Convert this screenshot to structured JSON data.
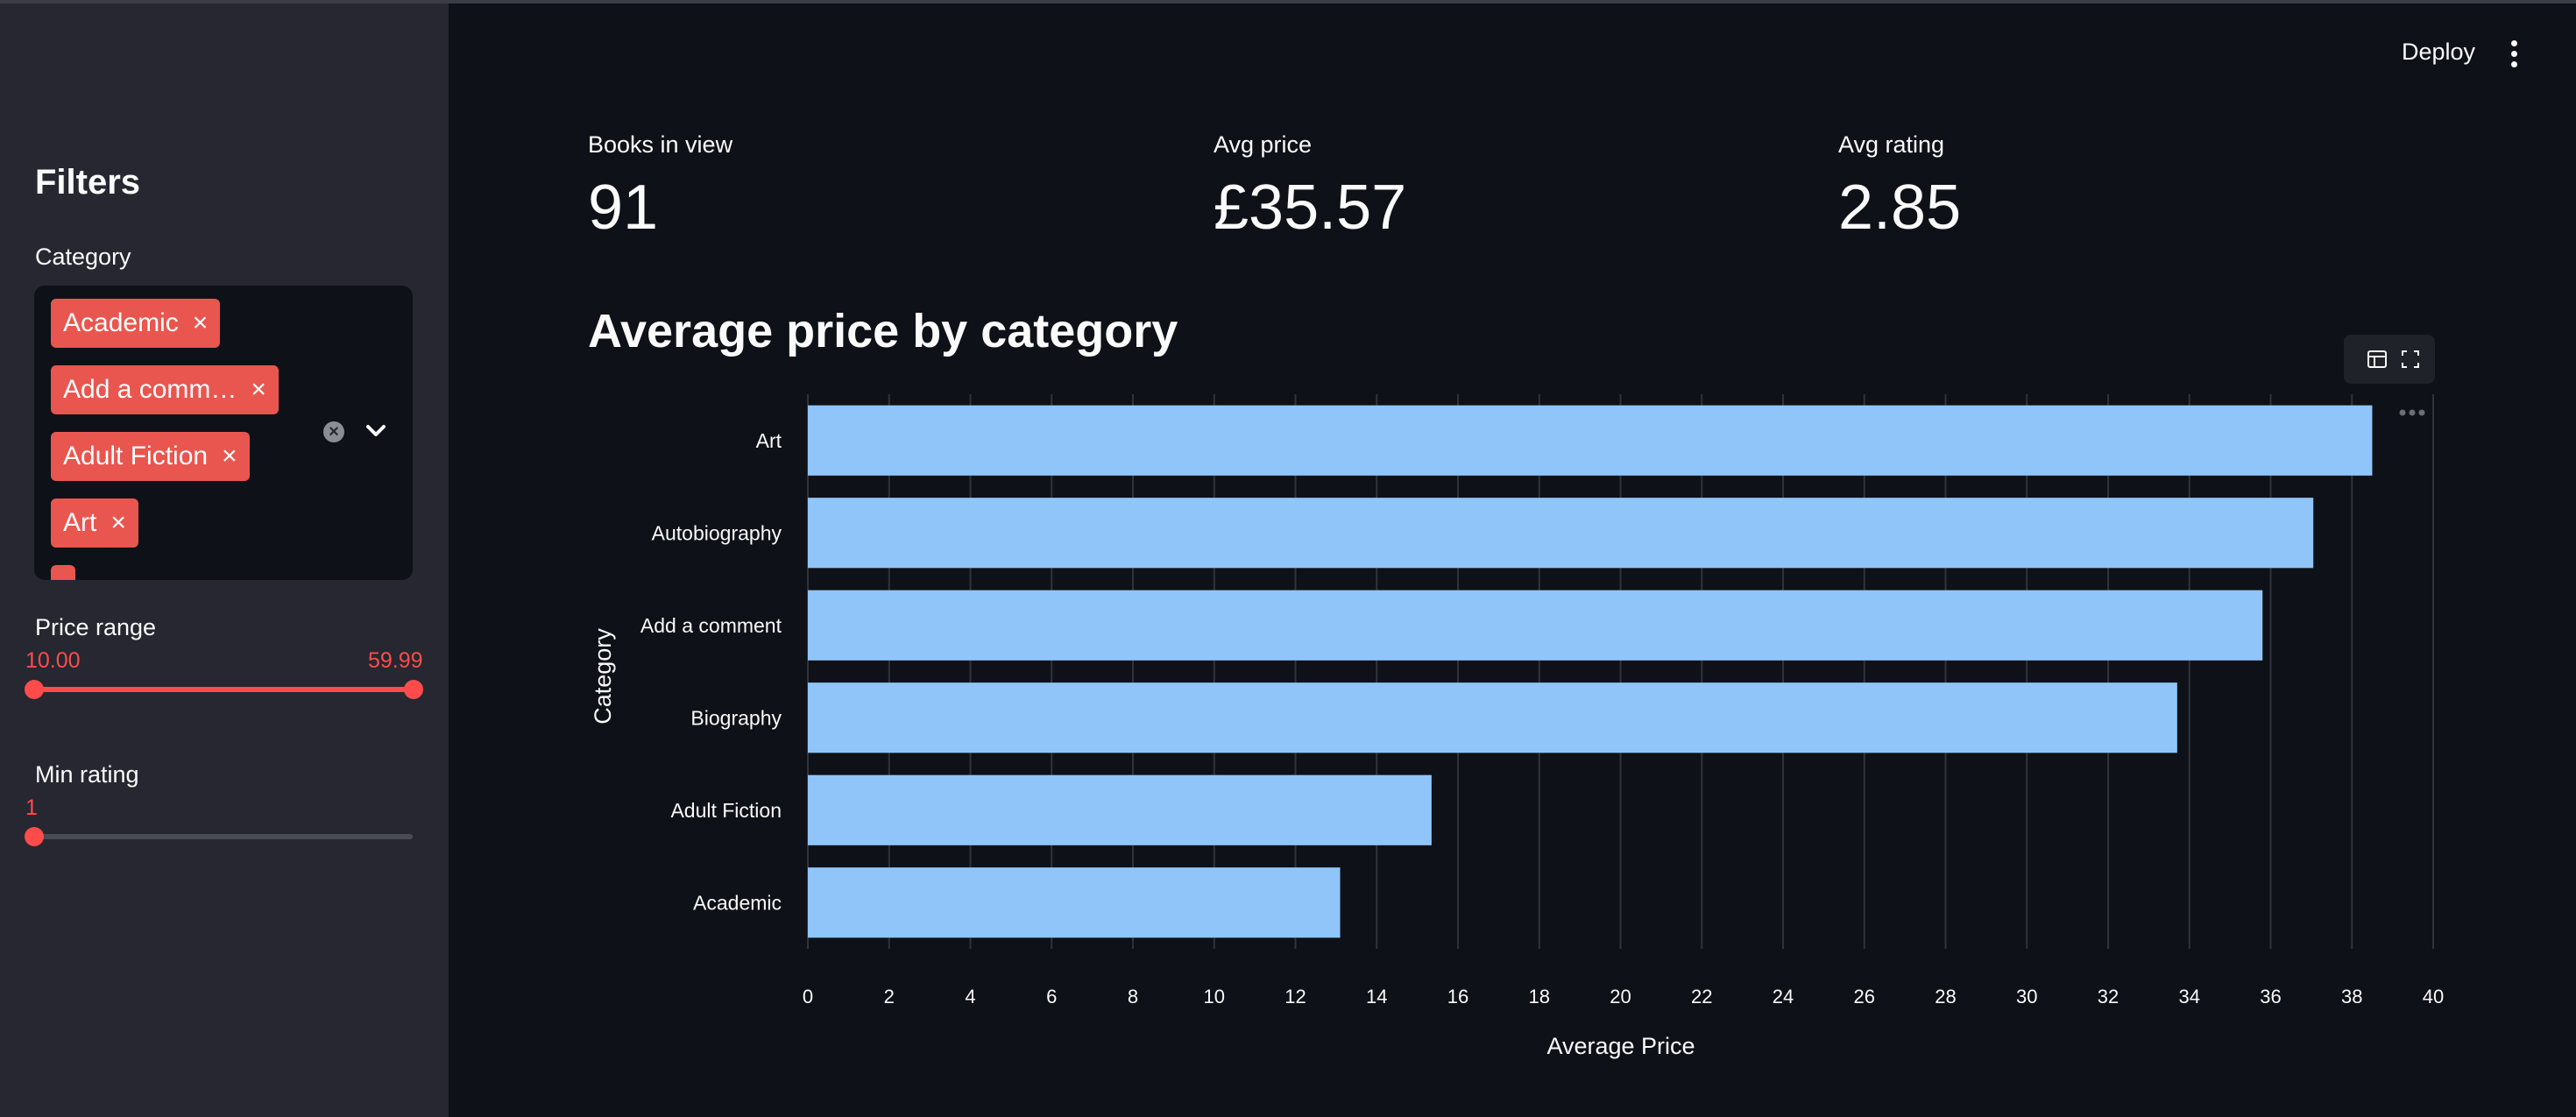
{
  "sidebar": {
    "title": "Filters",
    "category_label": "Category",
    "selected_categories": [
      "Academic",
      "Add a comm…",
      "Adult Fiction",
      "Art"
    ],
    "price_label": "Price range",
    "price_min": "10.00",
    "price_max": "59.99",
    "rating_label": "Min rating",
    "rating_value": "1"
  },
  "header": {
    "deploy_label": "Deploy"
  },
  "metrics": {
    "books_label": "Books in view",
    "books_value": "91",
    "price_label": "Avg price",
    "price_value": "£35.57",
    "rating_label": "Avg rating",
    "rating_value": "2.85"
  },
  "section_title": "Average price by category",
  "colors": {
    "accent": "#ff4b4b",
    "tag": "#e9564f",
    "bar": "#90c5fa",
    "background": "#0e1117",
    "sidebar": "#262730"
  },
  "icons": [
    "clear-icon",
    "chevron-down-icon",
    "table-icon",
    "fullscreen-icon",
    "more-options-icon",
    "kebab-menu-icon"
  ],
  "chart_data": {
    "type": "bar",
    "orientation": "horizontal",
    "categories": [
      "Art",
      "Autobiography",
      "Add a comment",
      "Biography",
      "Adult Fiction",
      "Academic"
    ],
    "values": [
      38.5,
      37.05,
      35.8,
      33.7,
      15.35,
      13.1
    ],
    "xlabel": "Average Price",
    "ylabel": "Category",
    "xlim": [
      0,
      40
    ],
    "xticks": [
      0,
      2,
      4,
      6,
      8,
      10,
      12,
      14,
      16,
      18,
      20,
      22,
      24,
      26,
      28,
      30,
      32,
      34,
      36,
      38,
      40
    ],
    "grid": true
  }
}
